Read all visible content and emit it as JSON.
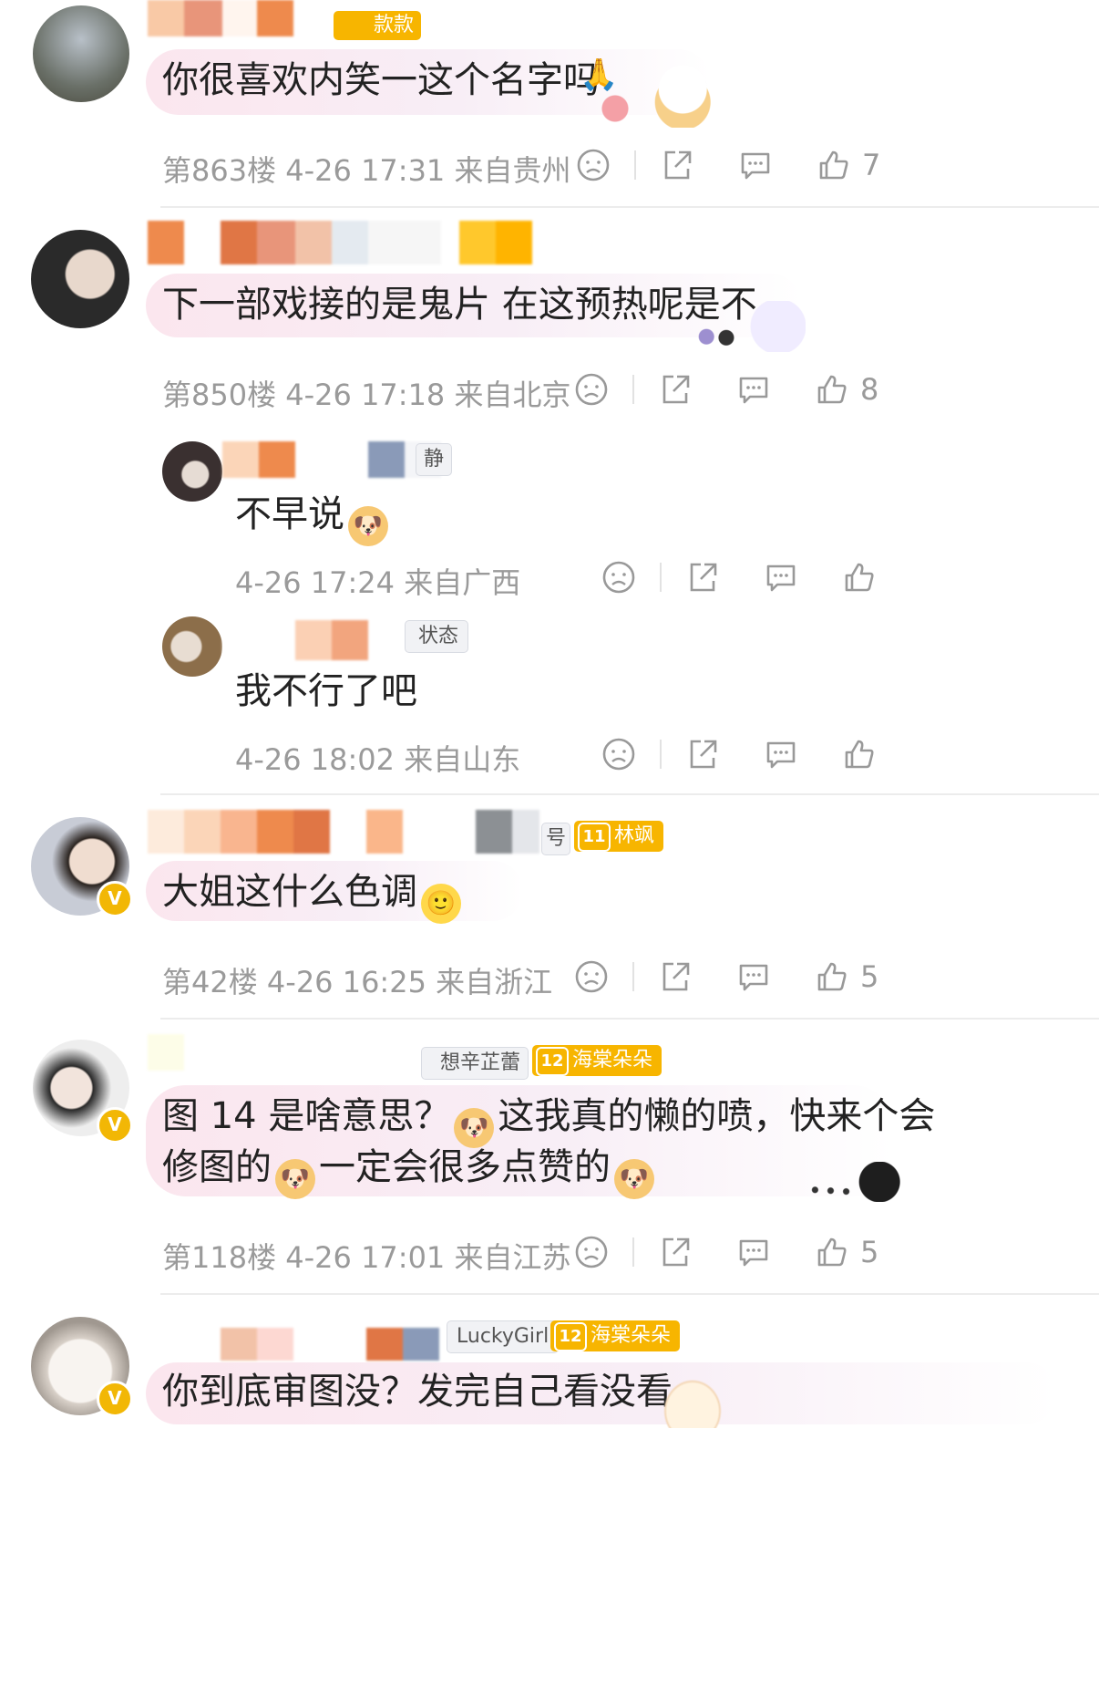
{
  "comments": [
    {
      "tags": [
        "款款"
      ],
      "text": "你很喜欢内笑一这个名字吗",
      "floor": "第863楼",
      "time": "4-26 17:31",
      "location": "来自贵州",
      "likes": "7"
    },
    {
      "text": "下一部戏接的是鬼片 在这预热呢是不",
      "floor": "第850楼",
      "time": "4-26 17:18",
      "location": "来自北京",
      "likes": "8",
      "replies": [
        {
          "tag": "静",
          "text": "不早说",
          "time": "4-26 17:24",
          "location": "来自广西"
        },
        {
          "tag": "状态",
          "text": "我不行了吧",
          "time": "4-26 18:02",
          "location": "来自山东"
        }
      ]
    },
    {
      "tag_gray": "号",
      "tag_gold_level": "11",
      "tag_gold": "林飒",
      "text": "大姐这什么色调",
      "floor": "第42楼",
      "time": "4-26 16:25",
      "location": "来自浙江",
      "likes": "5"
    },
    {
      "tag_gray": "想辛芷蕾",
      "tag_gold_level": "12",
      "tag_gold": "海棠朵朵",
      "text_line1_a": "图 14 是啥意思？",
      "text_line1_b": "这我真的懒的喷，快来个会",
      "text_line2_a": "修图的",
      "text_line2_b": "一定会很多点赞的",
      "floor": "第118楼",
      "time": "4-26 17:01",
      "location": "来自江苏",
      "likes": "5"
    },
    {
      "tag_gray": "LuckyGirl",
      "tag_gold_level": "12",
      "tag_gold": "海棠朵朵",
      "text": "你到底审图没？发完自己看没看"
    }
  ],
  "verified_badge": "V",
  "icons": [
    "dislike-icon",
    "share-icon",
    "comment-icon",
    "like-icon"
  ]
}
